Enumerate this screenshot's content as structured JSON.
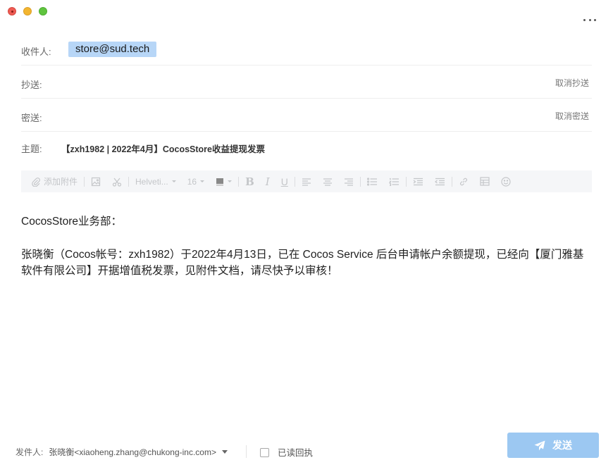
{
  "window": {
    "more_icon": "more-horizontal-icon"
  },
  "header": {
    "to_label": "收件人:",
    "to_recipient": "store@sud.tech",
    "cc_label": "抄送:",
    "cc_action": "取消抄送",
    "bcc_label": "密送:",
    "bcc_action": "取消密送",
    "subject_label": "主题:",
    "subject_value": "【zxh1982 | 2022年4月】CocosStore收益提现发票"
  },
  "toolbar": {
    "attach_label": "添加附件",
    "font_family": "Helveti...",
    "font_size": "16",
    "bold": "B",
    "italic": "I",
    "underline": "U"
  },
  "message": {
    "greeting": "CocosStore业务部：",
    "content": "张晓衡（Cocos帐号：zxh1982）于2022年4月13日，已在 Cocos Service 后台申请帐户余额提现，已经向【厦门雅基软件有限公司】开据增值税发票，见附件文档，请尽快予以审核！"
  },
  "footer": {
    "sender_label": "发件人:",
    "sender_value": "张晓衡<xiaoheng.zhang@chukong-inc.com>",
    "read_receipt_label": "已读回执",
    "read_receipt_checked": false,
    "send_label": "发送"
  },
  "colors": {
    "chip_bg": "#b7d6f7",
    "send_button": "#9cc8f2",
    "toolbar_bg": "#f5f6f8"
  }
}
